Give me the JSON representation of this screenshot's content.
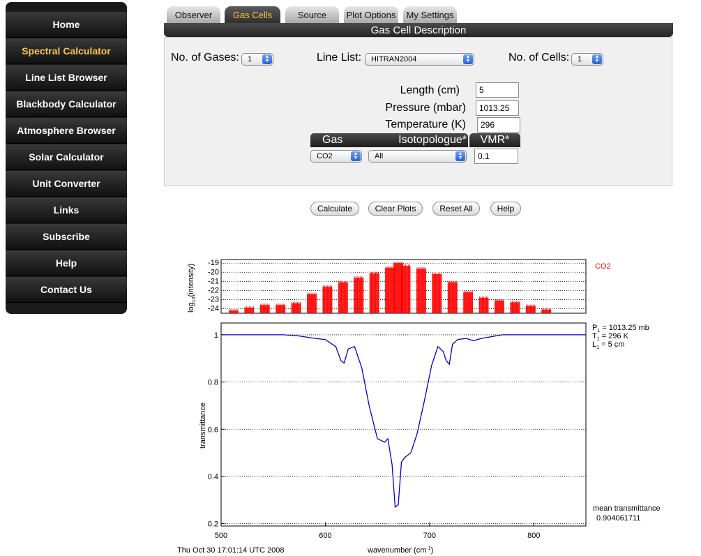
{
  "sidebar": {
    "items": [
      {
        "label": "Home"
      },
      {
        "label": "Spectral Calculator"
      },
      {
        "label": "Line List Browser"
      },
      {
        "label": "Blackbody Calculator"
      },
      {
        "label": "Atmosphere Browser"
      },
      {
        "label": "Solar Calculator"
      },
      {
        "label": "Unit Converter"
      },
      {
        "label": "Links"
      },
      {
        "label": "Subscribe"
      },
      {
        "label": "Help"
      },
      {
        "label": "Contact Us"
      }
    ],
    "active_index": 1
  },
  "tabs": [
    {
      "label": "Observer"
    },
    {
      "label": "Gas Cells"
    },
    {
      "label": "Source"
    },
    {
      "label": "Plot Options"
    },
    {
      "label": "My Settings"
    }
  ],
  "active_tab": 1,
  "panel": {
    "title": "Gas Cell Description",
    "no_gases_label": "No. of Gases:",
    "no_gases_value": "1",
    "line_list_label": "Line List:",
    "line_list_value": "HITRAN2004",
    "no_cells_label": "No. of Cells:",
    "no_cells_value": "1",
    "length_label": "Length (cm)",
    "length_value": "5",
    "pressure_label": "Pressure (mbar)",
    "pressure_value": "1013.25",
    "temperature_label": "Temperature (K)",
    "temperature_value": "296",
    "col_gas": "Gas",
    "col_isotopologue": "Isotopologue*",
    "col_vmr": "VMR*",
    "gas_value": "CO2",
    "isotopologue_value": "All",
    "vmr_value": "0.1"
  },
  "buttons": {
    "calculate": "Calculate",
    "clear_plots": "Clear Plots",
    "reset_all": "Reset All",
    "help": "Help"
  },
  "colors": {
    "accent": "#f5c64d",
    "intensity": "#ff0000",
    "transmittance": "#0000cc",
    "select_arrow": "#2a62d8"
  },
  "chart_data": [
    {
      "type": "bar",
      "ylabel_main": "log",
      "ylabel_sub": "10",
      "ylabel_rest": "(intensity)",
      "xlim": [
        500,
        850
      ],
      "ylim": [
        -24.5,
        -18.6
      ],
      "yticks": [
        -19,
        -20,
        -21,
        -22,
        -23,
        -24
      ],
      "grid": true,
      "legend": {
        "label": "CO2",
        "color": "#ff0000",
        "position": "top-right"
      },
      "series": [
        {
          "name": "CO2",
          "color": "#ff0000",
          "x": [
            512,
            527,
            542,
            557,
            572,
            587,
            602,
            617,
            632,
            647,
            662,
            670,
            677,
            692,
            707,
            722,
            737,
            752,
            767,
            782,
            797,
            812
          ],
          "y": [
            -24.2,
            -23.9,
            -23.6,
            -23.6,
            -23.4,
            -22.4,
            -21.6,
            -21.1,
            -20.6,
            -20.1,
            -19.5,
            -19.0,
            -19.3,
            -19.6,
            -20.2,
            -21.1,
            -22.2,
            -22.8,
            -23.1,
            -23.3,
            -23.7,
            -24.1
          ]
        }
      ]
    },
    {
      "type": "line",
      "xlabel": "wavenumber (cm",
      "xlabel_sup": "-1",
      "xlabel_end": ")",
      "ylabel": "transmittance",
      "xlim": [
        500,
        850
      ],
      "ylim": [
        0.19,
        1.05
      ],
      "xticks": [
        500,
        600,
        700,
        800
      ],
      "yticks": [
        0.2,
        0.4,
        0.6,
        0.8,
        1
      ],
      "grid": true,
      "series": [
        {
          "name": "",
          "color": "#0000cc",
          "x": [
            500,
            560,
            575,
            590,
            600,
            610,
            615,
            618,
            622,
            628,
            635,
            642,
            650,
            657,
            660,
            664,
            667,
            670,
            673,
            676,
            682,
            688,
            695,
            702,
            708,
            713,
            716,
            719,
            722,
            727,
            735,
            742,
            750,
            770,
            850
          ],
          "y": [
            1.0,
            1.0,
            0.995,
            0.985,
            0.98,
            0.95,
            0.89,
            0.88,
            0.94,
            0.95,
            0.86,
            0.7,
            0.56,
            0.545,
            0.56,
            0.45,
            0.27,
            0.28,
            0.46,
            0.48,
            0.5,
            0.58,
            0.72,
            0.87,
            0.95,
            0.93,
            0.89,
            0.875,
            0.96,
            0.98,
            0.985,
            0.975,
            0.985,
            1.0,
            1.0
          ]
        }
      ],
      "annotations": {
        "p_label": "P",
        "p_sub": "1",
        "p_value": " = 1013.25 mb",
        "t_label": "T",
        "t_sub": "1",
        "t_value": " = 296 K",
        "l_label": "L",
        "l_sub": "1",
        "l_value": " = 5 cm",
        "mean_label": "mean transmittance",
        "mean_value": "0.904061711",
        "timestamp": "Thu Oct 30 17:01:14 UTC 2008"
      }
    }
  ]
}
